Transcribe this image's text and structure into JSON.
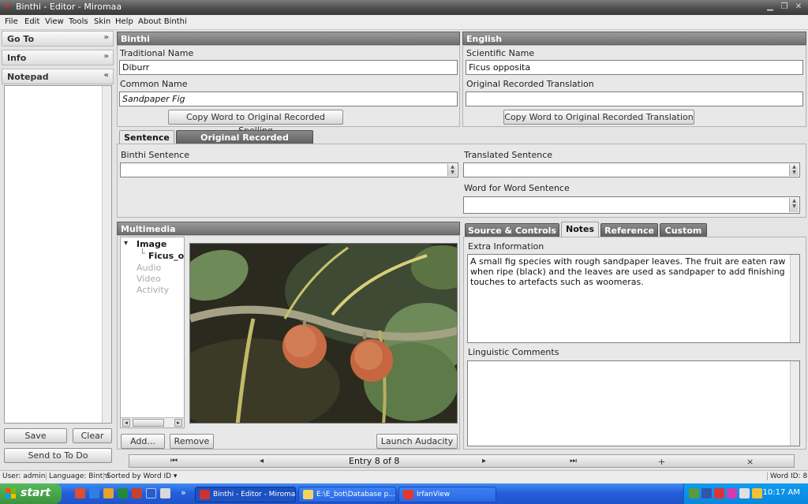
{
  "window": {
    "title": "Binthi - Editor - Miromaa",
    "controls": [
      "minimize-icon",
      "restore-icon",
      "close-icon"
    ]
  },
  "menu": [
    "File",
    "Edit",
    "View",
    "Tools",
    "Skin",
    "Help",
    "About Binthi"
  ],
  "left_panel": {
    "goto": "Go To",
    "info": "Info",
    "notepad": "Notepad",
    "notepad_text": "",
    "save": "Save",
    "clear": "Clear",
    "send_todo": "Send to To Do"
  },
  "binthi": {
    "header": "Binthi",
    "traditional_label": "Traditional Name",
    "traditional_value": "Diburr",
    "common_label": "Common Name",
    "common_value": "Sandpaper Fig",
    "copy_button": "Copy Word to Original Recorded Spelling"
  },
  "english": {
    "header": "English",
    "scientific_label": "Scientific Name",
    "scientific_value": "Ficus opposita",
    "orig_translation_label": "Original Recorded Translation",
    "orig_translation_value": "",
    "copy_button": "Copy Word to Original Recorded Translation"
  },
  "sentence": {
    "tabs": [
      "Sentence",
      "Original Recorded Sentence"
    ],
    "binthi_label": "Binthi Sentence",
    "binthi_value": "",
    "translated_label": "Translated Sentence",
    "translated_value": "",
    "wfw_label": "Word for Word Sentence",
    "wfw_value": ""
  },
  "multimedia": {
    "header": "Multimedia",
    "tree": {
      "image": "Image",
      "image_child": "Ficus_o",
      "audio": "Audio",
      "video": "Video",
      "activity": "Activity"
    },
    "add": "Add...",
    "remove": "Remove",
    "launch": "Launch Audacity"
  },
  "notes": {
    "tabs": [
      "Source & Controls",
      "Notes",
      "Reference",
      "Custom"
    ],
    "active_tab": "Notes",
    "extra_label": "Extra Information",
    "extra_text": "A small fig species with rough sandpaper leaves. The fruit are eaten raw when ripe (black) and the leaves are used as sandpaper to add finishing touches to artefacts such as woomeras.",
    "ling_label": "Linguistic Comments",
    "ling_text": ""
  },
  "nav": {
    "first": "⏮",
    "prev": "◂",
    "entry": "Entry 8 of 8",
    "next": "▸",
    "last": "⏭",
    "add": "+",
    "delete": "×"
  },
  "status": {
    "user": "User: admin",
    "language": "Language: Binthi",
    "sorted": "Sorted by Word ID ▾",
    "word_id": "Word ID: 8"
  },
  "taskbar": {
    "start": "start",
    "tasks": [
      "Binthi - Editor - Miromaa",
      "E:\\E_bot\\Database p...",
      "IrfanView"
    ],
    "clock": "10:17 AM",
    "overflow": "»"
  }
}
